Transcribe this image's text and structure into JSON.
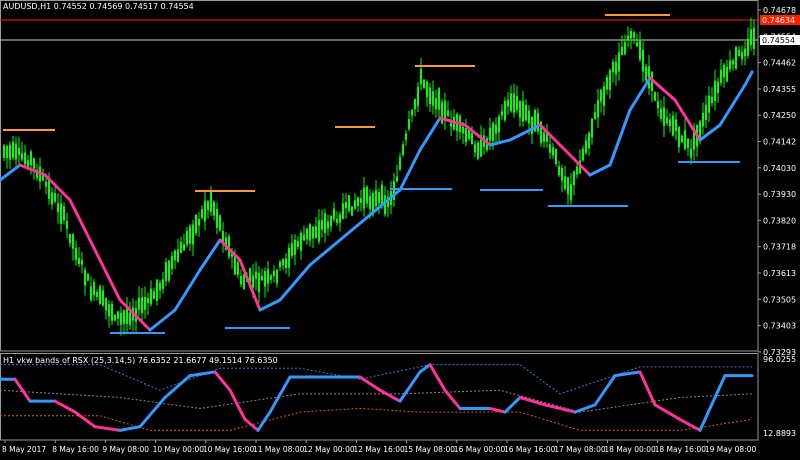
{
  "main_chart": {
    "symbol_line": "AUDUSD,H1  0.74552 0.74569 0.74517 0.74554",
    "price_labels": [
      "0.74678",
      "0.74554",
      "0.74462",
      "0.74355",
      "0.74250",
      "0.74142",
      "0.74030",
      "0.73930",
      "0.73820",
      "0.73718",
      "0.73613",
      "0.73505",
      "0.73403",
      "0.73293"
    ],
    "current_price_tag": "0.74554",
    "red_line_tag": "0.74634",
    "colors": {
      "background": "#000000",
      "up_candle": "#00ff00",
      "down_candle": "#00ff00",
      "rising_line": "#3399ff",
      "falling_line": "#ff3399",
      "resistance": "#ff9933",
      "support": "#3399ff",
      "red_line": "#ff2200"
    }
  },
  "indicator": {
    "label": "H1  vkw bands of RSX (25,3.14,5) 76.6352 21.6677 49.1514 76.6350",
    "top_value": "96.0255",
    "bottom_value": "12.8893"
  },
  "time_axis": [
    "8 May 2017",
    "8 May 16:00",
    "9 May 08:00",
    "10 May 00:00",
    "10 May 16:00",
    "11 May 08:00",
    "12 May 00:00",
    "12 May 16:00",
    "15 May 08:00",
    "16 May 00:00",
    "16 May 16:00",
    "17 May 08:00",
    "18 May 00:00",
    "18 May 16:00",
    "19 May 08:00"
  ]
}
